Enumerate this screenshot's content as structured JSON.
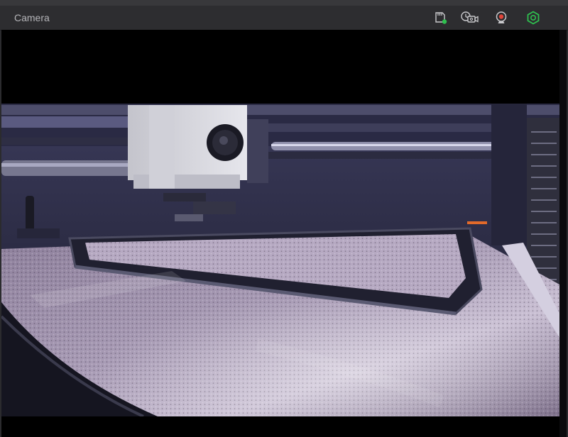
{
  "header": {
    "title": "Camera"
  },
  "icons": {
    "storage": "sd-card-status-icon",
    "timelapse": "timelapse-camera-icon",
    "recording": "recording-webcam-icon",
    "connection": "connection-status-icon"
  },
  "colors": {
    "status_green": "#2fbf4f",
    "record_red": "#e0453a",
    "header_bg": "#2d2d30",
    "feed_bg": "#000000"
  }
}
